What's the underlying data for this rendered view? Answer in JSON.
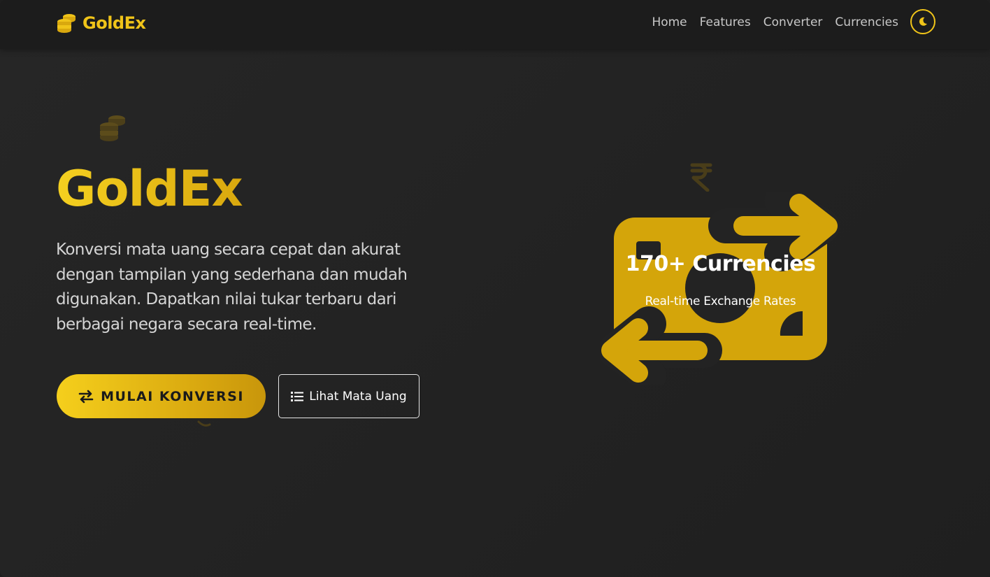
{
  "brand": {
    "name": "GoldEx",
    "icon": "coins-icon",
    "accent": "#f0c419"
  },
  "nav": {
    "items": [
      {
        "label": "Home"
      },
      {
        "label": "Features"
      },
      {
        "label": "Converter"
      },
      {
        "label": "Currencies"
      }
    ],
    "theme_toggle_icon": "moon-icon"
  },
  "hero": {
    "title": "GoldEx",
    "description": "Konversi mata uang secara cepat dan akurat dengan tampilan yang sederhana dan mudah digunakan. Dapatkan nilai tukar terbaru dari berbagai negara secara real-time.",
    "primary_button": {
      "label": "MULAI KONVERSI",
      "icon": "exchange-arrows-icon"
    },
    "secondary_button": {
      "label": "Lihat Mata Uang",
      "icon": "list-icon"
    }
  },
  "illustration": {
    "icon": "money-exchange-icon",
    "title": "170+ Currencies",
    "subtitle": "Real-time Exchange Rates"
  }
}
